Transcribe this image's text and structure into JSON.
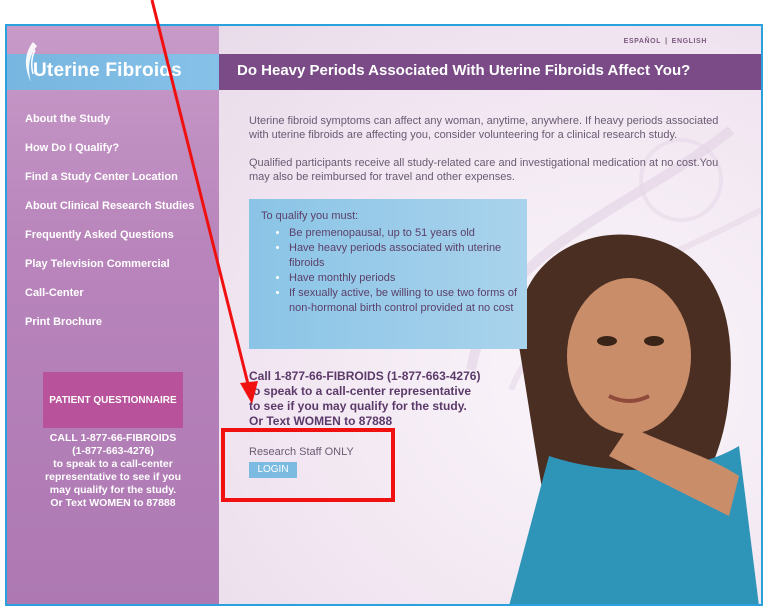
{
  "languages": [
    "ESPAÑOL",
    "ENGLISH"
  ],
  "logo": {
    "text": "Uterine Fibroids"
  },
  "nav": [
    "About the Study",
    "How Do I Qualify?",
    "Find a Study Center Location",
    "About Clinical Research Studies",
    "Frequently Asked Questions",
    "Play Television Commercial",
    "Call-Center",
    "Print Brochure"
  ],
  "patient_questionnaire": "PATIENT QUESTIONNAIRE",
  "sidebar_call": [
    "CALL 1-877-66-FIBROIDS",
    "(1-877-663-4276)",
    "to speak to a call-center",
    "representative to see if you",
    "may qualify for the study.",
    "Or Text WOMEN to 87888"
  ],
  "title": "Do Heavy Periods Associated With Uterine Fibroids Affect You?",
  "intro": [
    "Uterine fibroid symptoms can affect any woman, anytime, anywhere. If heavy periods associated with uterine fibroids are affecting you, consider volunteering for a clinical research study.",
    "Qualified participants receive all study-related care and investigational medication at no cost.You may also be reimbursed for travel and other expenses."
  ],
  "qualify": {
    "heading": "To qualify you must:",
    "items": [
      "Be premenopausal, up to 51 years old",
      "Have heavy periods associated with uterine fibroids",
      "Have monthly periods",
      "If sexually active, be willing to use two forms of non-hormonal birth control provided at no cost"
    ]
  },
  "cta_lines": [
    "Call 1-877-66-FIBROIDS (1-877-663-4276)",
    "to speak to a call-center representative",
    "to see if you may qualify for the study.",
    "Or Text WOMEN to 87888"
  ],
  "research_staff": "Research Staff ONLY",
  "login_label": "LOGIN",
  "colors": {
    "sidebar": "#b884bb",
    "title_bar": "#7a4b86",
    "accent_blue": "#7bbbe2",
    "questionnaire": "#b8529b",
    "annotation_red": "#f01010"
  }
}
